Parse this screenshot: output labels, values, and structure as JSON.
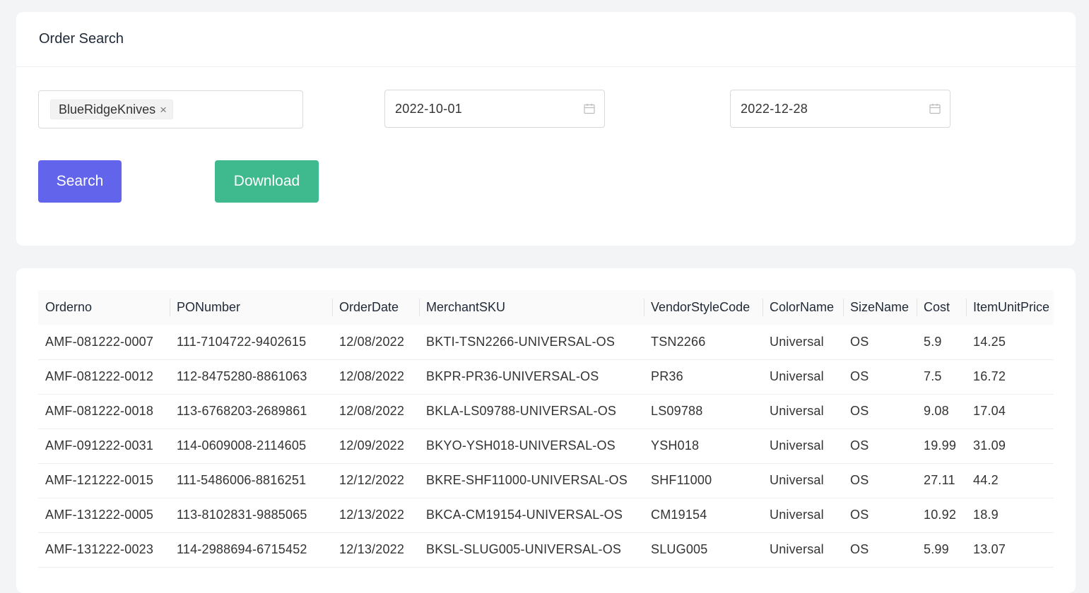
{
  "header": {
    "title": "Order Search"
  },
  "filters": {
    "store_tag": "BlueRidgeKnives",
    "tag_close": "×",
    "date_from": "2022-10-01",
    "date_to": "2022-12-28"
  },
  "buttons": {
    "search": "Search",
    "download": "Download"
  },
  "table": {
    "columns": [
      "Orderno",
      "PONumber",
      "OrderDate",
      "MerchantSKU",
      "VendorStyleCode",
      "ColorName",
      "SizeName",
      "Cost",
      "ItemUnitPrice"
    ],
    "rows": [
      [
        "AMF-081222-0007",
        "111-7104722-9402615",
        "12/08/2022",
        "BKTI-TSN2266-UNIVERSAL-OS",
        "TSN2266",
        "Universal",
        "OS",
        "5.9",
        "14.25"
      ],
      [
        "AMF-081222-0012",
        "112-8475280-8861063",
        "12/08/2022",
        "BKPR-PR36-UNIVERSAL-OS",
        "PR36",
        "Universal",
        "OS",
        "7.5",
        "16.72"
      ],
      [
        "AMF-081222-0018",
        "113-6768203-2689861",
        "12/08/2022",
        "BKLA-LS09788-UNIVERSAL-OS",
        "LS09788",
        "Universal",
        "OS",
        "9.08",
        "17.04"
      ],
      [
        "AMF-091222-0031",
        "114-0609008-2114605",
        "12/09/2022",
        "BKYO-YSH018-UNIVERSAL-OS",
        "YSH018",
        "Universal",
        "OS",
        "19.99",
        "31.09"
      ],
      [
        "AMF-121222-0015",
        "111-5486006-8816251",
        "12/12/2022",
        "BKRE-SHF11000-UNIVERSAL-OS",
        "SHF11000",
        "Universal",
        "OS",
        "27.11",
        "44.2"
      ],
      [
        "AMF-131222-0005",
        "113-8102831-9885065",
        "12/13/2022",
        "BKCA-CM19154-UNIVERSAL-OS",
        "CM19154",
        "Universal",
        "OS",
        "10.92",
        "18.9"
      ],
      [
        "AMF-131222-0023",
        "114-2988694-6715452",
        "12/13/2022",
        "BKSL-SLUG005-UNIVERSAL-OS",
        "SLUG005",
        "Universal",
        "OS",
        "5.99",
        "13.07"
      ]
    ]
  }
}
